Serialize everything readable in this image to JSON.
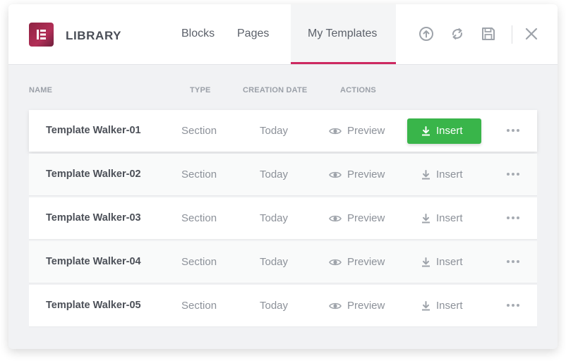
{
  "header": {
    "brand": "LIBRARY",
    "tabs": [
      {
        "label": "Blocks",
        "active": false
      },
      {
        "label": "Pages",
        "active": false
      },
      {
        "label": "My Templates",
        "active": true
      }
    ],
    "buttons": [
      "upload-icon",
      "sync-icon",
      "save-icon",
      "close-icon"
    ],
    "accent_color": "#cd2960"
  },
  "columns": [
    "Name",
    "Type",
    "Creation Date",
    "Actions"
  ],
  "rows": [
    {
      "name": "Template Walker-01",
      "type": "Section",
      "date": "Today",
      "preview": "Preview",
      "insert": "Insert",
      "highlighted": true
    },
    {
      "name": "Template Walker-02",
      "type": "Section",
      "date": "Today",
      "preview": "Preview",
      "insert": "Insert",
      "highlighted": false
    },
    {
      "name": "Template Walker-03",
      "type": "Section",
      "date": "Today",
      "preview": "Preview",
      "insert": "Insert",
      "highlighted": false
    },
    {
      "name": "Template Walker-04",
      "type": "Section",
      "date": "Today",
      "preview": "Preview",
      "insert": "Insert",
      "highlighted": false
    },
    {
      "name": "Template Walker-05",
      "type": "Section",
      "date": "Today",
      "preview": "Preview",
      "insert": "Insert",
      "highlighted": false
    }
  ],
  "colors": {
    "insert_primary": "#39b54a",
    "logo": "#9b2a4d"
  }
}
